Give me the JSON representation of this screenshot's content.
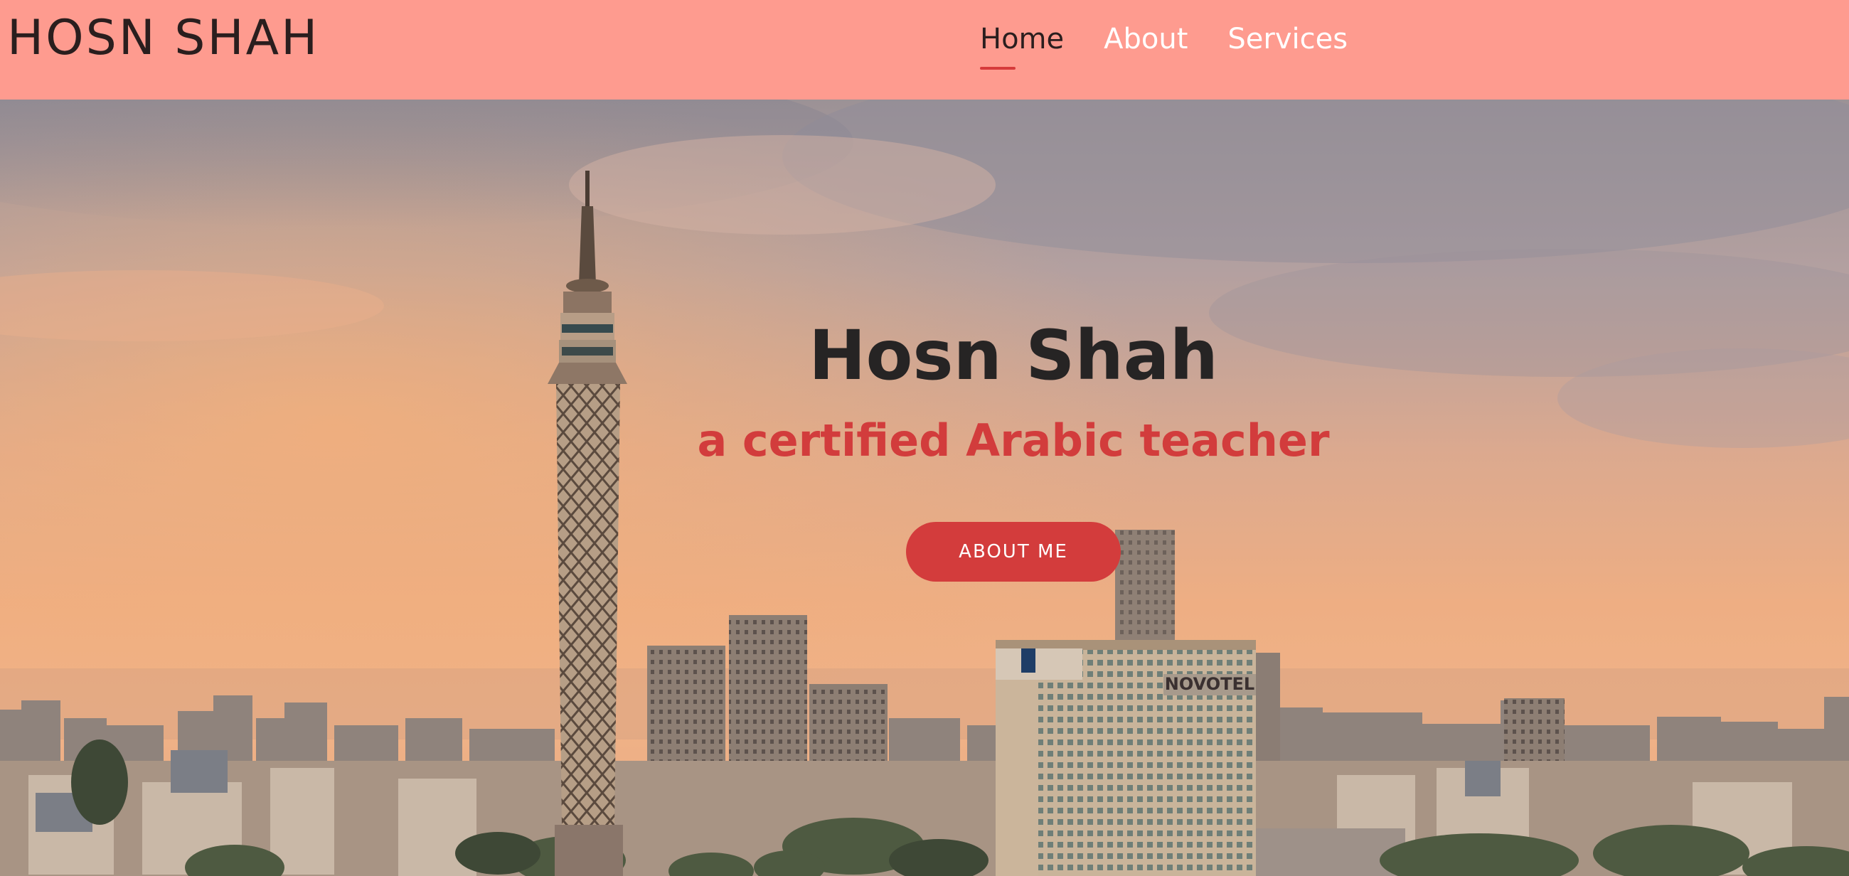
{
  "header": {
    "logo": "HOSN SHAH",
    "nav": [
      {
        "label": "Home",
        "active": true
      },
      {
        "label": "About",
        "active": false
      },
      {
        "label": "Services",
        "active": false
      }
    ]
  },
  "hero": {
    "title": "Hosn Shah",
    "subtitle": "a certified Arabic teacher",
    "button_label": "ABOUT ME",
    "background_image": "Cairo skyline at dusk with Cairo Tower",
    "hotel_sign": "NOVOTEL"
  },
  "colors": {
    "header_bg": "#fe9b8f",
    "accent": "#d33c3c",
    "text_dark": "#262424",
    "nav_text": "#ffffff"
  }
}
